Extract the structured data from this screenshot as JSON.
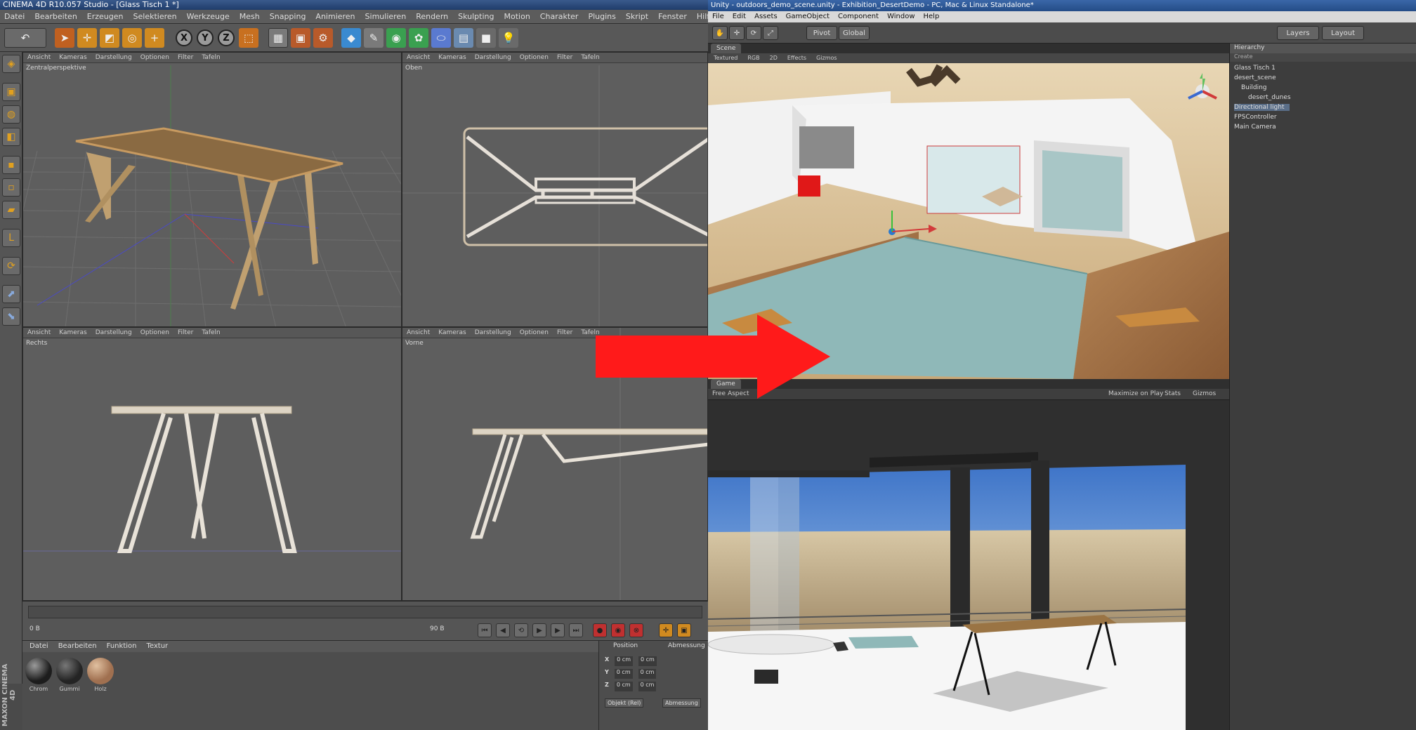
{
  "c4d": {
    "title": "CINEMA 4D R10.057 Studio - [Glass Tisch 1 *]",
    "menu": [
      "Datei",
      "Bearbeiten",
      "Erzeugen",
      "Selektieren",
      "Werkzeuge",
      "Mesh",
      "Snapping",
      "Animieren",
      "Simulieren",
      "Rendern",
      "Skulpting",
      "Motion",
      "Charakter",
      "Plugins",
      "Skript",
      "Fenster",
      "Hilfe"
    ],
    "viewports": [
      {
        "name": "Zentralperspektive",
        "menu": [
          "Ansicht",
          "Kameras",
          "Darstellung",
          "Optionen",
          "Filter",
          "Tafeln"
        ]
      },
      {
        "name": "Oben",
        "menu": [
          "Ansicht",
          "Kameras",
          "Darstellung",
          "Optionen",
          "Filter",
          "Tafeln"
        ]
      },
      {
        "name": "Rechts",
        "menu": [
          "Ansicht",
          "Kameras",
          "Darstellung",
          "Optionen",
          "Filter",
          "Tafeln"
        ]
      },
      {
        "name": "Vorne",
        "menu": [
          "Ansicht",
          "Kameras",
          "Darstellung",
          "Optionen",
          "Filter",
          "Tafeln"
        ]
      }
    ],
    "timeline": {
      "frame": "0 B",
      "end": "90 B"
    },
    "materials": {
      "menu": [
        "Datei",
        "Bearbeiten",
        "Funktion",
        "Textur"
      ],
      "items": [
        {
          "label": "Chrom",
          "color": "#1d1d1d"
        },
        {
          "label": "Gummi",
          "color": "#242424"
        },
        {
          "label": "Holz",
          "color": "#a07050"
        }
      ]
    },
    "coords": {
      "title": "Position",
      "size_label": "Abmessung",
      "rows": [
        {
          "axis": "X",
          "pos": "0 cm",
          "size": "0 cm"
        },
        {
          "axis": "Y",
          "pos": "0 cm",
          "size": "0 cm"
        },
        {
          "axis": "Z",
          "pos": "0 cm",
          "size": "0 cm"
        }
      ],
      "buttons": [
        "Objekt (Rel)",
        "Abmessung"
      ]
    },
    "brand": "MAXON CINEMA 4D"
  },
  "unity": {
    "title": "Unity - outdoors_demo_scene.unity - Exhibition_DesertDemo - PC, Mac & Linux Standalone*",
    "menu": [
      "File",
      "Edit",
      "Assets",
      "GameObject",
      "Component",
      "Window",
      "Help"
    ],
    "toolbar": {
      "pivot": "Pivot",
      "global": "Global",
      "layers": "Layers",
      "layout": "Layout"
    },
    "scene_tab": "Scene",
    "scene_shading": "Textured",
    "scene_options": [
      "RGB",
      "2D",
      "Effects",
      "Gizmos"
    ],
    "game_tab": "Game",
    "game_aspect": "Free Aspect",
    "game_options": [
      "Maximize on Play",
      "Stats",
      "Gizmos"
    ],
    "hierarchy_title": "Hierarchy",
    "hierarchy_create": "Create",
    "hierarchy": [
      {
        "label": "Glass Tisch 1",
        "indent": 0
      },
      {
        "label": "desert_scene",
        "indent": 0
      },
      {
        "label": "Building",
        "indent": 1
      },
      {
        "label": "desert_dunes",
        "indent": 2
      },
      {
        "label": "Directional light",
        "indent": 0,
        "selected": true
      },
      {
        "label": "FPSController",
        "indent": 0
      },
      {
        "label": "Main Camera",
        "indent": 0
      }
    ]
  },
  "colors": {
    "arrow": "#ff1a1a",
    "c4d_viewport": "#5e5e5e",
    "unity_panel": "#3a3a3a",
    "table_wood": "#8a6a42",
    "sky": "#4a7ec8",
    "pool": "#8fb8b8",
    "sand": "#d8c098"
  }
}
